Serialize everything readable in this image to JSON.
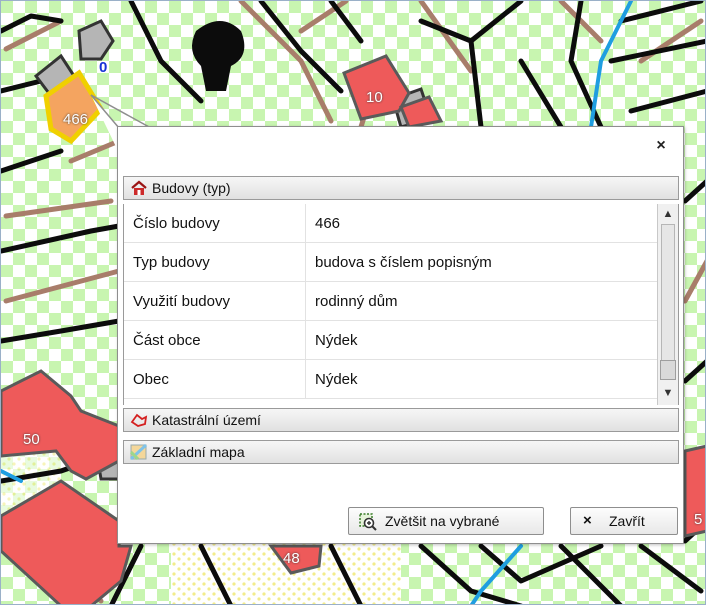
{
  "map": {
    "labels": {
      "zero": "0",
      "b466": "466",
      "b10": "10",
      "b50": "50",
      "b48": "48",
      "b5": "5"
    }
  },
  "popup": {
    "close_glyph": "×",
    "sections": {
      "budovy": "Budovy (typ)",
      "katastralni": "Katastrální území",
      "zakladni": "Základní mapa"
    },
    "rows": [
      {
        "key": "Číslo budovy",
        "value": "466"
      },
      {
        "key": "Typ budovy",
        "value": "budova s číslem popisným"
      },
      {
        "key": "Využití budovy",
        "value": "rodinný dům"
      },
      {
        "key": "Část obce",
        "value": "Nýdek"
      },
      {
        "key": "Obec",
        "value": "Nýdek"
      }
    ],
    "icons": {
      "budovy": "house-icon",
      "katastralni": "parcel-outline-icon",
      "zakladni": "map-layer-icon",
      "zoom": "zoom-to-selection-icon",
      "close": "close-x-icon"
    },
    "buttons": {
      "zoom_label": "Zvětšit na vybrané",
      "close_label": "Zavřít"
    },
    "scrollbar": {
      "up": "▲",
      "down": "▼"
    }
  },
  "colors": {
    "building_fill": "#ee5a5a",
    "selected_building": "#f4a460",
    "selected_outline": "#f0d000",
    "parcel_line": "#000000",
    "path_line": "#a87d6a",
    "water_line": "#1f9ee0",
    "meadow": "#c8f5b0"
  }
}
